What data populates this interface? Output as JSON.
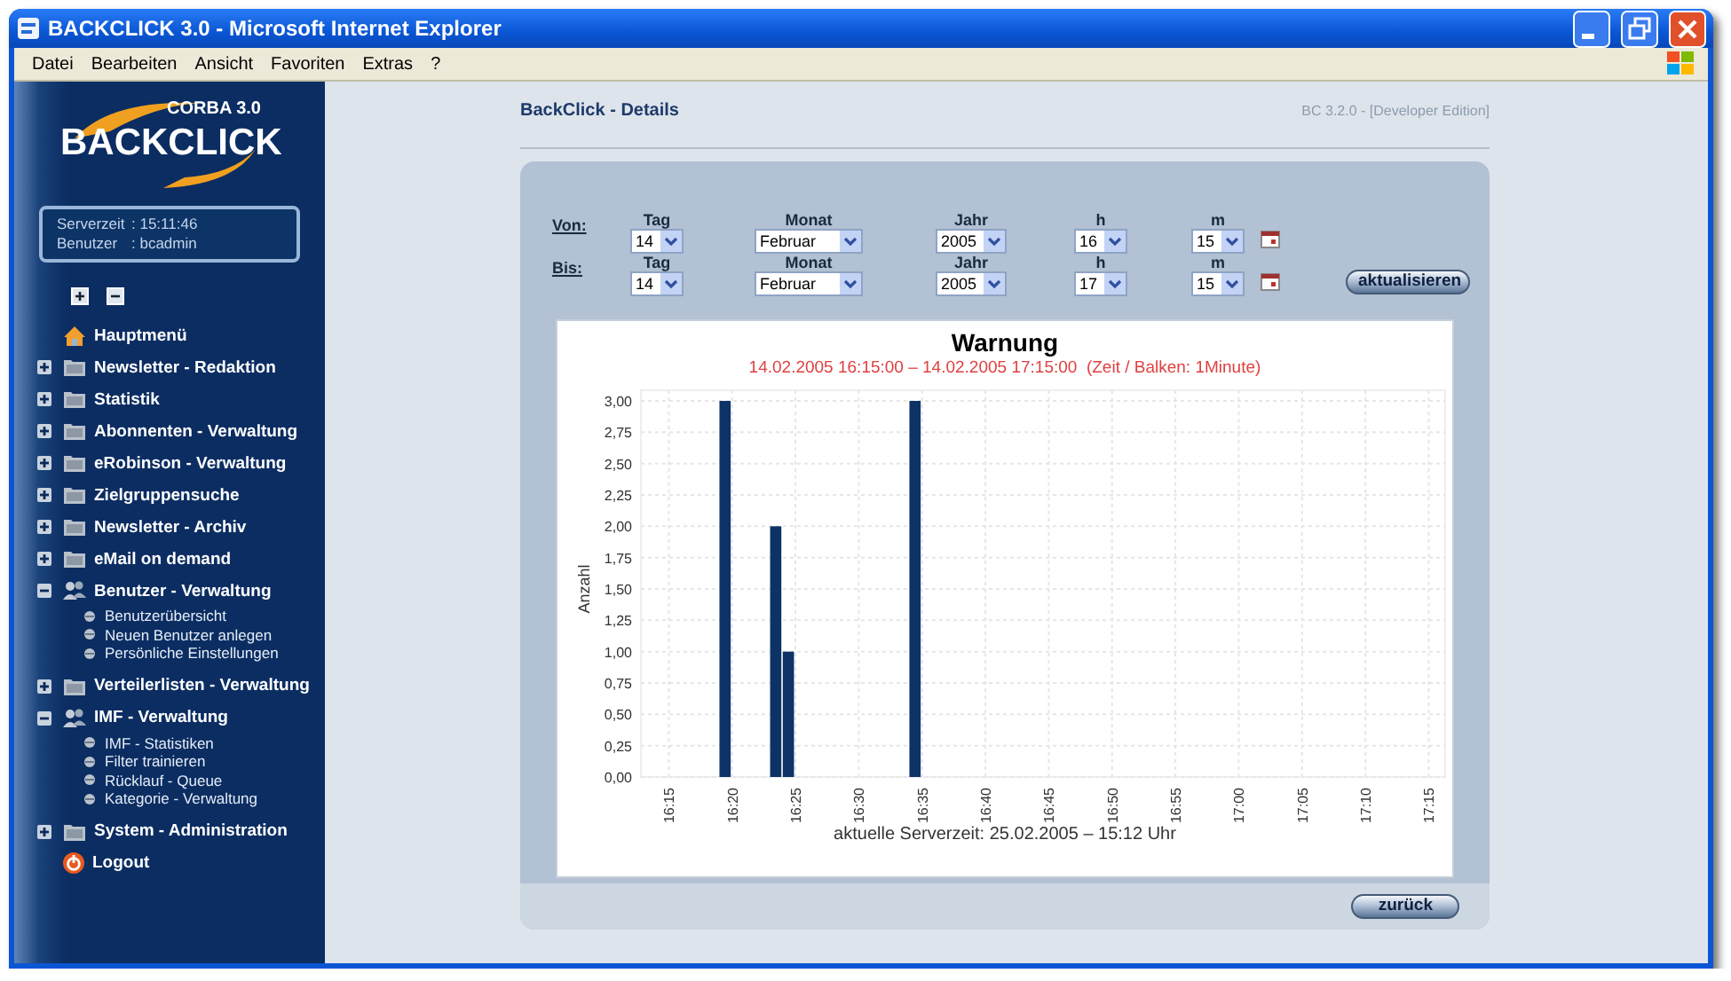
{
  "window": {
    "title": "BACKCLICK 3.0 - Microsoft Internet Explorer"
  },
  "menu": [
    "Datei",
    "Bearbeiten",
    "Ansicht",
    "Favoriten",
    "Extras",
    "?"
  ],
  "sidebar": {
    "logo": {
      "edition": "CORBA 3.0",
      "name": "BACKCLICK"
    },
    "info": [
      {
        "label": "Serverzeit",
        "value": ": 15:11:46"
      },
      {
        "label": "Benutzer",
        "value": ": bcadmin"
      }
    ],
    "items": [
      {
        "kind": "home",
        "label": "Hauptmenü"
      },
      {
        "kind": "folder",
        "label": "Newsletter - Redaktion",
        "expanded": false
      },
      {
        "kind": "folder",
        "label": "Statistik",
        "expanded": false
      },
      {
        "kind": "folder",
        "label": "Abonnenten - Verwaltung",
        "expanded": false
      },
      {
        "kind": "folder",
        "label": "eRobinson - Verwaltung",
        "expanded": false
      },
      {
        "kind": "folder",
        "label": "Zielgruppensuche",
        "expanded": false
      },
      {
        "kind": "folder",
        "label": "Newsletter - Archiv",
        "expanded": false
      },
      {
        "kind": "folder",
        "label": "eMail on demand",
        "expanded": false
      },
      {
        "kind": "folder",
        "label": "Benutzer - Verwaltung",
        "expanded": true,
        "children": [
          {
            "label": "Benutzerübersicht"
          },
          {
            "label": "Neuen Benutzer anlegen"
          },
          {
            "label": "Persönliche Einstellungen"
          }
        ]
      },
      {
        "kind": "folder",
        "label": "Verteilerlisten - Verwaltung",
        "expanded": false
      },
      {
        "kind": "folder",
        "label": "IMF - Verwaltung",
        "expanded": true,
        "children": [
          {
            "label": "IMF - Statistiken"
          },
          {
            "label": "Filter trainieren"
          },
          {
            "label": "Rücklauf - Queue"
          },
          {
            "label": "Kategorie - Verwaltung"
          }
        ]
      },
      {
        "kind": "folder",
        "label": "System - Administration",
        "expanded": false
      },
      {
        "kind": "logout",
        "label": "Logout"
      }
    ]
  },
  "page": {
    "title": "BackClick - Details",
    "version": "BC 3.2.0 - [Developer Edition]"
  },
  "filter": {
    "rows": [
      {
        "label": "Von:",
        "fields": [
          {
            "label": "Tag",
            "value": "14"
          },
          {
            "label": "Monat",
            "value": "Februar"
          },
          {
            "label": "Jahr",
            "value": "2005"
          },
          {
            "label": "h",
            "value": "16"
          },
          {
            "label": "m",
            "value": "15"
          }
        ]
      },
      {
        "label": "Bis:",
        "fields": [
          {
            "label": "Tag",
            "value": "14"
          },
          {
            "label": "Monat",
            "value": "Februar"
          },
          {
            "label": "Jahr",
            "value": "2005"
          },
          {
            "label": "h",
            "value": "17"
          },
          {
            "label": "m",
            "value": "15"
          }
        ]
      }
    ],
    "button": "aktualisieren"
  },
  "chart": {
    "subtitle": "14.02.2005 16:15:00 – 14.02.2005 17:15:00  (Zeit / Balken: 1Minute)",
    "footer": "aktuelle Serverzeit: 25.02.2005 – 15:12 Uhr",
    "chart_data": {
      "type": "bar",
      "title": "Warnung",
      "ylabel": "Anzahl",
      "categories": [
        "16:15",
        null,
        null,
        null,
        null,
        "16:20",
        null,
        null,
        null,
        null,
        "16:25",
        null,
        null,
        null,
        null,
        "16:30",
        null,
        null,
        null,
        null,
        "16:35",
        null,
        null,
        null,
        null,
        "16:40",
        null,
        null,
        null,
        null,
        "16:45",
        null,
        null,
        null,
        null,
        "16:50",
        null,
        null,
        null,
        null,
        "16:55",
        null,
        null,
        null,
        null,
        "17:00",
        null,
        null,
        null,
        null,
        "17:05",
        null,
        null,
        null,
        null,
        "17:10",
        null,
        null,
        null,
        null,
        "17:15"
      ],
      "grid": true,
      "series": [
        {
          "color": "#0d3266",
          "values": [
            null,
            null,
            null,
            null,
            null,
            3,
            null,
            null,
            null,
            2,
            1,
            null,
            null,
            null,
            null,
            null,
            null,
            null,
            null,
            null,
            3,
            null,
            null,
            null,
            null,
            null,
            null,
            null,
            null,
            null,
            null,
            null,
            null,
            null,
            null,
            null,
            null,
            null,
            null,
            null,
            null,
            null,
            null,
            null,
            null,
            null,
            null,
            null,
            null,
            null,
            null,
            null,
            null,
            null,
            null,
            null,
            null,
            null,
            null,
            null,
            null
          ]
        }
      ],
      "ylim": [
        0,
        3
      ],
      "yticks": [
        {
          "value": 0,
          "label": "0,00"
        },
        {
          "value": 0.25,
          "label": "0,25"
        },
        {
          "value": 0.5,
          "label": "0,50"
        },
        {
          "value": 0.75,
          "label": "0,75"
        },
        {
          "value": 1,
          "label": "1,00"
        },
        {
          "value": 1.25,
          "label": "1,25"
        },
        {
          "value": 1.5,
          "label": "1,50"
        },
        {
          "value": 1.75,
          "label": "1,75"
        },
        {
          "value": 2,
          "label": "2,00"
        },
        {
          "value": 2.25,
          "label": "2,25"
        },
        {
          "value": 2.5,
          "label": "2,50"
        },
        {
          "value": 2.75,
          "label": "2,75"
        },
        {
          "value": 3,
          "label": "3,00"
        }
      ]
    }
  },
  "back_button": "zurück"
}
